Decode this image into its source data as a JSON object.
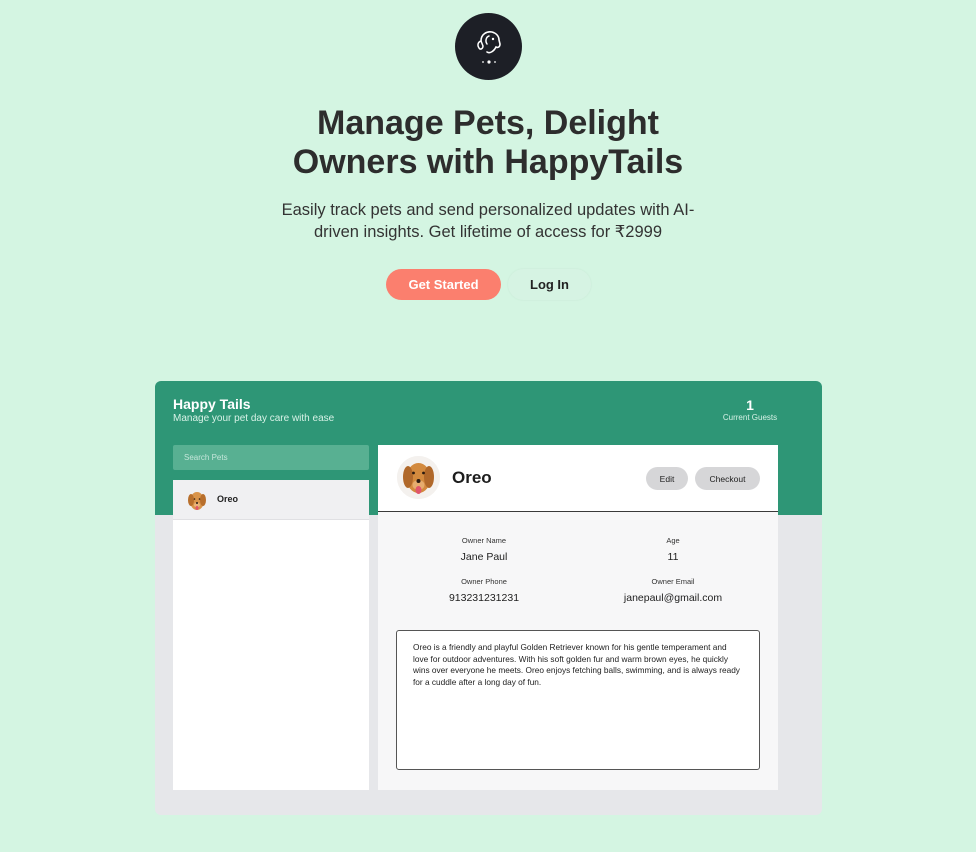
{
  "hero": {
    "title_line1": "Manage Pets, Delight",
    "title_line2": "Owners with HappyTails",
    "subtitle_line1": "Easily track pets and send personalized updates with AI-",
    "subtitle_line2": "driven insights. Get lifetime of access for ₹2999",
    "get_started": "Get Started",
    "login": "Log In",
    "logo_icon": "dog-face-icon"
  },
  "app": {
    "title": "Happy Tails",
    "subtitle": "Manage your pet day care with ease",
    "guest_count": "1",
    "guest_label": "Current Guests",
    "search_placeholder": "Search Pets",
    "pets": [
      {
        "name": "Oreo"
      }
    ],
    "add_label": "+"
  },
  "detail": {
    "name": "Oreo",
    "edit_label": "Edit",
    "checkout_label": "Checkout",
    "owner_name_label": "Owner Name",
    "owner_name": "Jane Paul",
    "age_label": "Age",
    "age": "11",
    "owner_phone_label": "Owner Phone",
    "owner_phone": "913231231231",
    "owner_email_label": "Owner Email",
    "owner_email": "janepaul@gmail.com",
    "notes": "Oreo is a friendly and playful Golden Retriever known for his gentle temperament and love for outdoor adventures. With his soft golden fur and warm brown eyes, he quickly wins over everyone he meets. Oreo enjoys fetching balls, swimming, and is always ready for a cuddle after a long day of fun."
  },
  "colors": {
    "background": "#d4f5e2",
    "accent_green": "#2e9676",
    "cta_coral": "#fb7f6e",
    "dark": "#1d1f26"
  }
}
